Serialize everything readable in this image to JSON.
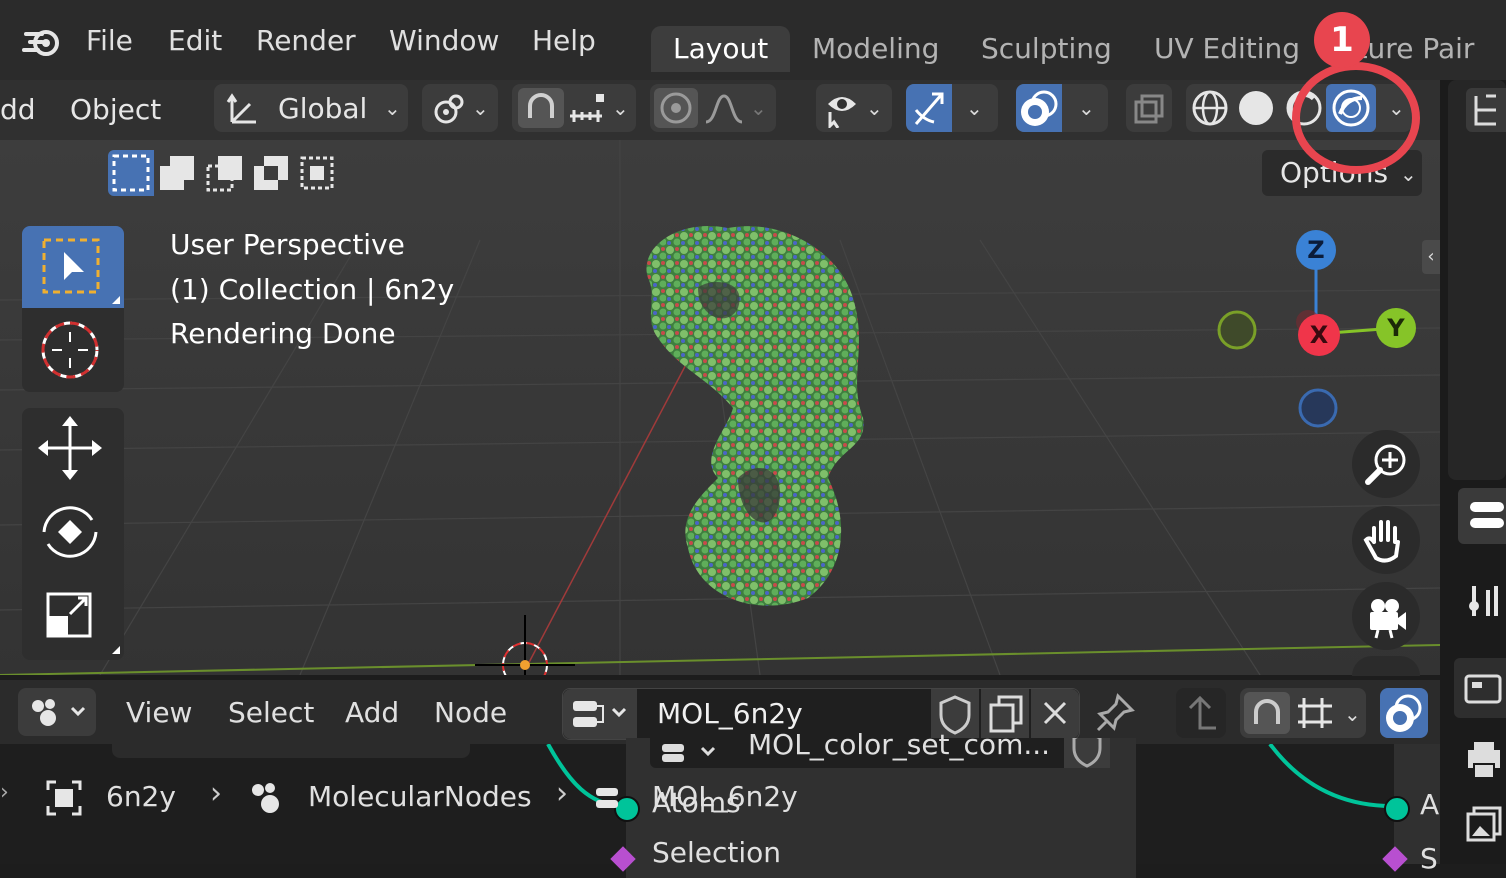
{
  "menu": {
    "file": "File",
    "edit": "Edit",
    "render": "Render",
    "window": "Window",
    "help": "Help"
  },
  "workspaces": {
    "layout": "Layout",
    "modeling": "Modeling",
    "sculpting": "Sculpting",
    "uv_editing": "UV Editing",
    "texture_paint": "xture Pair"
  },
  "header": {
    "add_partial": "dd",
    "object": "Object",
    "orientation": "Global",
    "options": "Options"
  },
  "viewport": {
    "line1": "User Perspective",
    "line2": "(1) Collection | 6n2y",
    "line3": "Rendering Done"
  },
  "gizmo": {
    "z": "Z",
    "y": "Y",
    "x": "X"
  },
  "annotation": {
    "step": "1"
  },
  "node_editor": {
    "view": "View",
    "select": "Select",
    "add": "Add",
    "node": "Node",
    "node_group": "MOL_6n2y",
    "node_partial": "MOL_color_set_com...",
    "breadcrumb": {
      "object": "6n2y",
      "modifier": "MolecularNodes",
      "group": "MOL_6n2y"
    },
    "socket_atoms": "Atoms",
    "socket_selection": "Selection",
    "right_a": "A",
    "right_s": "S"
  },
  "colors": {
    "accent": "#4772b3",
    "annotation_red": "#e8454f",
    "axis_x": "#f0354a",
    "axis_y": "#86c428",
    "axis_z": "#3a82d6"
  }
}
